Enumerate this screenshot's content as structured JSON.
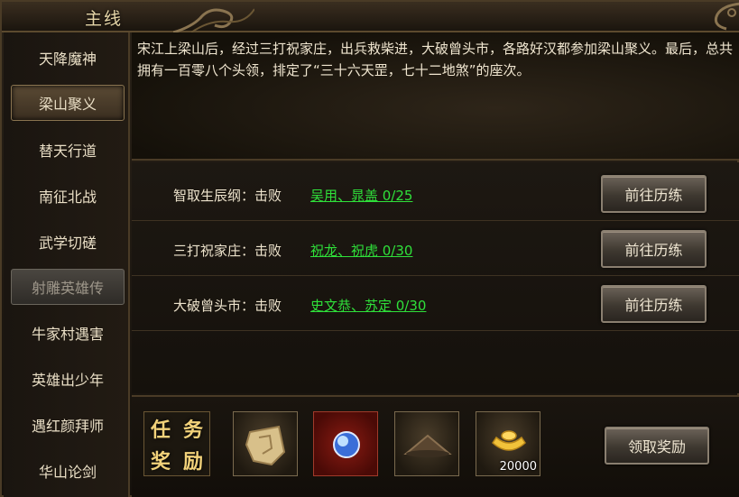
{
  "header": {
    "title": "主线"
  },
  "sidebar": {
    "items": [
      {
        "label": "天降魔神"
      },
      {
        "label": "梁山聚义"
      },
      {
        "label": "替天行道"
      },
      {
        "label": "南征北战"
      },
      {
        "label": "武学切磋"
      },
      {
        "label": "射雕英雄传"
      },
      {
        "label": "牛家村遇害"
      },
      {
        "label": "英雄出少年"
      },
      {
        "label": "遇红颜拜师"
      },
      {
        "label": "华山论剑"
      }
    ]
  },
  "story": {
    "text": "宋江上梁山后，经过三打祝家庄，出兵救柴进，大破曾头市，各路好汉都参加梁山聚义。最后，总共拥有一百零八个头领，排定了“三十六天罡，七十二地煞”的座次。"
  },
  "quests": [
    {
      "label": "智取生辰纲：击败",
      "target": "吴用、晁盖 0/25",
      "button": "前往历练"
    },
    {
      "label": "三打祝家庄：击败",
      "target": "祝龙、祝虎 0/30",
      "button": "前往历练"
    },
    {
      "label": "大破曾头市：击败",
      "target": "史文恭、苏定 0/30",
      "button": "前往历练"
    }
  ],
  "rewards": {
    "badge": [
      "任",
      "务",
      "奖",
      "励"
    ],
    "items": [
      {
        "icon": "map-scroll-icon"
      },
      {
        "icon": "blue-orb-icon"
      },
      {
        "icon": "straw-hat-icon"
      },
      {
        "icon": "gold-ingot-icon",
        "count": "20000"
      }
    ],
    "claim_button": "领取奖励"
  },
  "colors": {
    "accent": "#2fe03a",
    "gold": "#f2d27a",
    "border": "#4a3b26"
  }
}
